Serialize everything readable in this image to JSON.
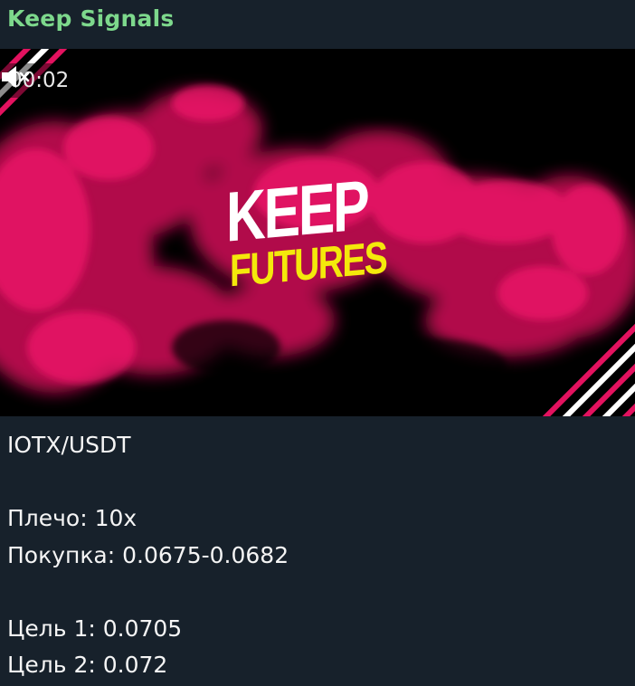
{
  "header": {
    "channel_name": "Keep Signals"
  },
  "media": {
    "duration": "00:02",
    "mute_icon": "volume-mute-icon",
    "brand_line1": "KEEP",
    "brand_line2": "FUTURES",
    "colors": {
      "smoke": "#e3125f",
      "brand_yellow": "#f4e90b",
      "background": "#000000"
    }
  },
  "message": {
    "pair": "IOTX/USDT",
    "leverage": "Плечо: 10x",
    "buy": "Покупка: 0.0675-0.0682",
    "target1": "Цель 1: 0.0705",
    "target2": "Цель 2: 0.072"
  },
  "colors": {
    "background": "#17212b",
    "channel_name": "#7dd88c",
    "text": "#f5f5f5"
  }
}
